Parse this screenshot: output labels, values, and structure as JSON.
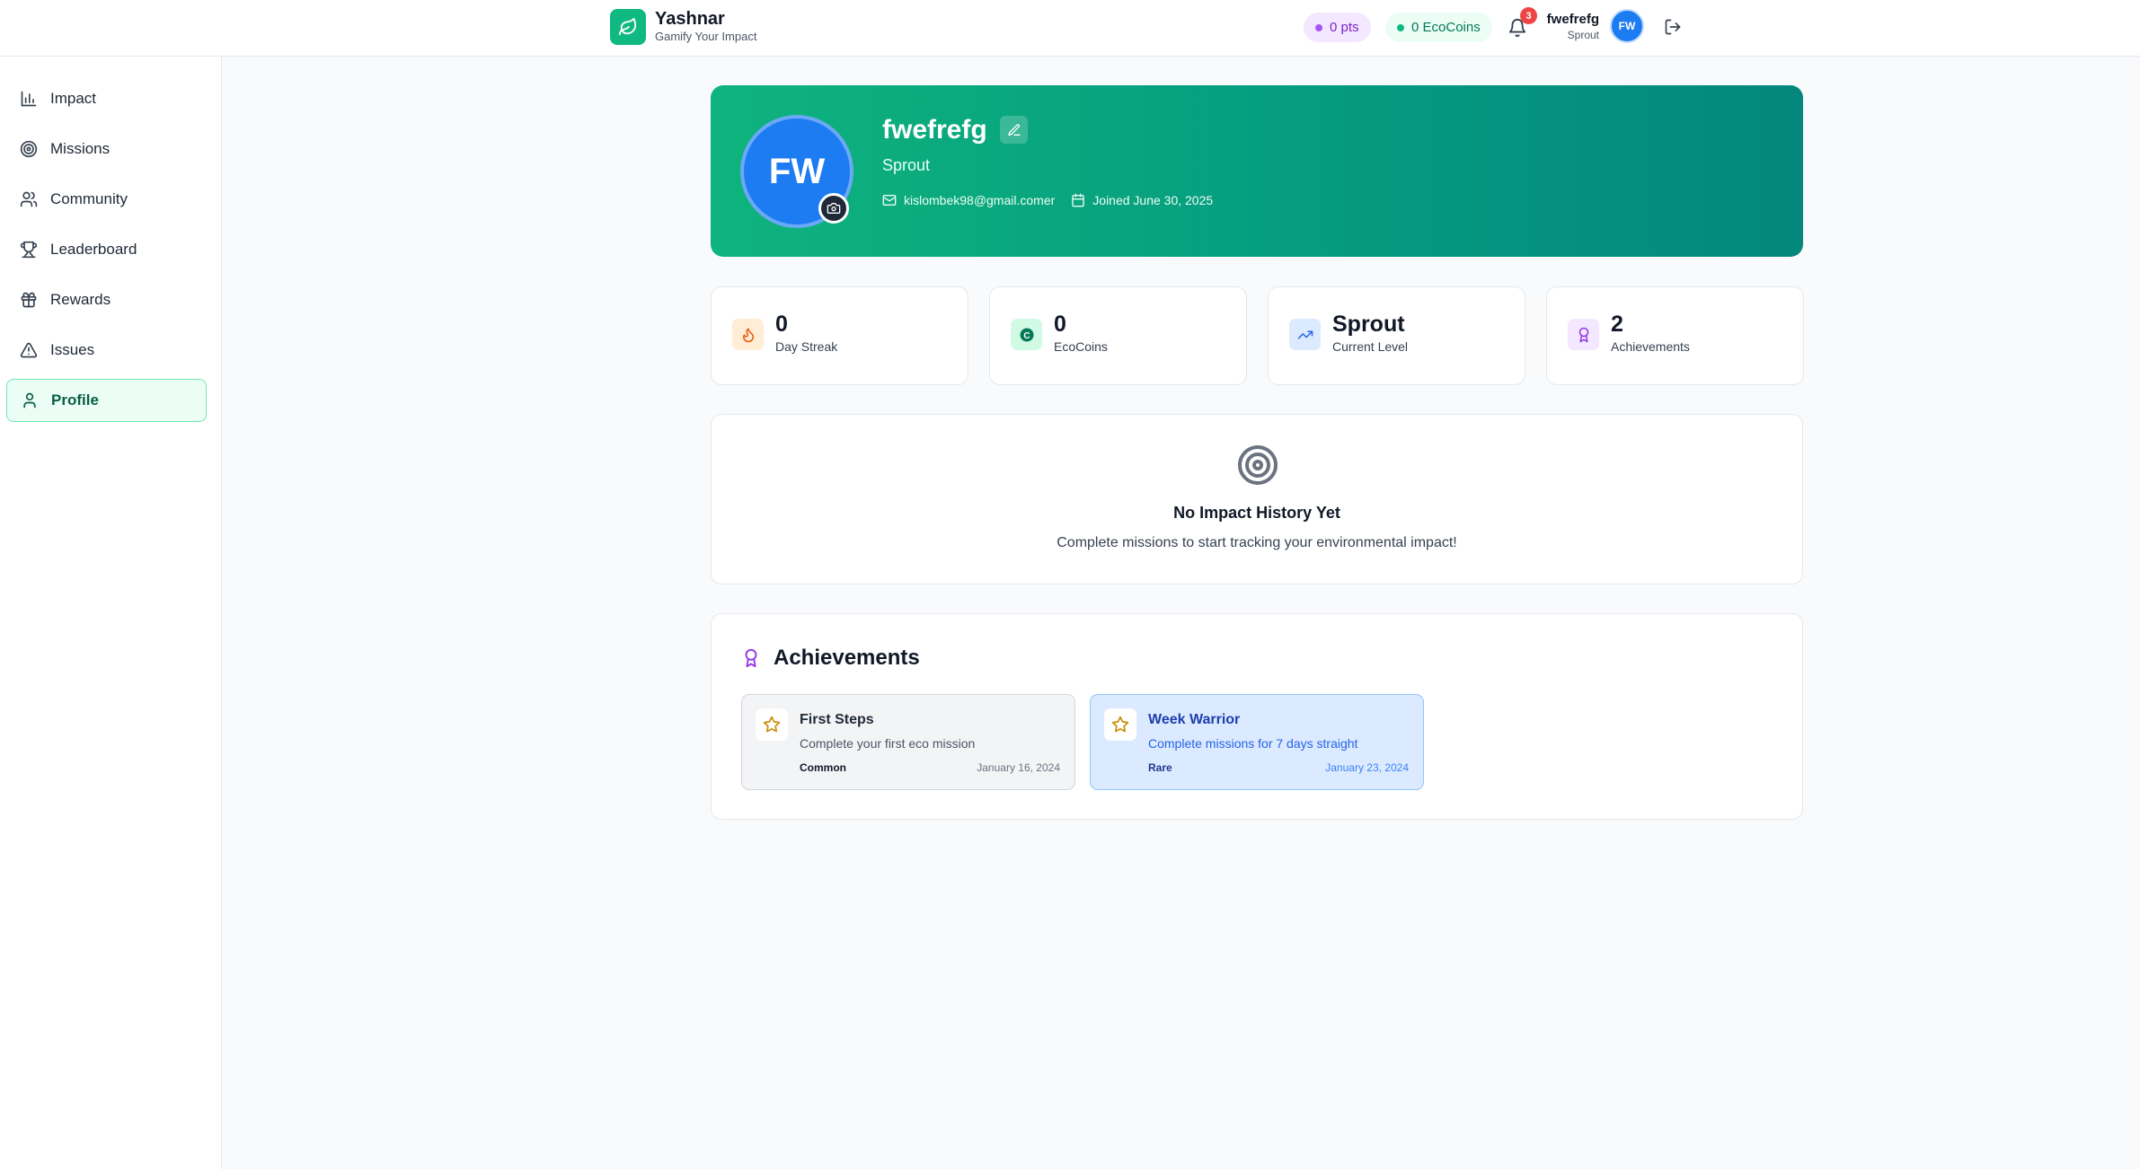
{
  "app": {
    "name": "Yashnar",
    "tagline": "Gamify Your Impact"
  },
  "header": {
    "points_label": "0 pts",
    "ecocoins_label": "0 EcoCoins",
    "notification_count": "3",
    "user_name": "fwefrefg",
    "user_level": "Sprout",
    "avatar_initials": "FW"
  },
  "sidebar": {
    "items": [
      {
        "label": "Impact",
        "icon": "bar-chart-icon"
      },
      {
        "label": "Missions",
        "icon": "target-icon"
      },
      {
        "label": "Community",
        "icon": "users-icon"
      },
      {
        "label": "Leaderboard",
        "icon": "trophy-icon"
      },
      {
        "label": "Rewards",
        "icon": "gift-icon"
      },
      {
        "label": "Issues",
        "icon": "alert-triangle-icon"
      },
      {
        "label": "Profile",
        "icon": "user-icon",
        "active": true
      }
    ]
  },
  "profile": {
    "initials": "FW",
    "name": "fwefrefg",
    "level": "Sprout",
    "email": "kislombek98@gmail.comer",
    "joined": "Joined June 30, 2025"
  },
  "stats": [
    {
      "value": "0",
      "label": "Day Streak",
      "icon": "flame-icon",
      "color": "#ea580c"
    },
    {
      "value": "0",
      "label": "EcoCoins",
      "icon": "coin-icon",
      "color": "#047857"
    },
    {
      "value": "Sprout",
      "label": "Current Level",
      "icon": "trending-up-icon",
      "color": "#2563eb"
    },
    {
      "value": "2",
      "label": "Achievements",
      "icon": "award-icon",
      "color": "#9333ea"
    }
  ],
  "impact_history": {
    "title": "No Impact History Yet",
    "text": "Complete missions to start tracking your environmental impact!"
  },
  "achievements": {
    "title": "Achievements",
    "items": [
      {
        "title": "First Steps",
        "description": "Complete your first eco mission",
        "rarity": "Common",
        "date": "January 16, 2024"
      },
      {
        "title": "Week Warrior",
        "description": "Complete missions for 7 days straight",
        "rarity": "Rare",
        "date": "January 23, 2024"
      }
    ]
  },
  "colors": {
    "brand": "#10b981",
    "avatar": "#1d7cf2",
    "accent_purple": "#a855f7"
  }
}
